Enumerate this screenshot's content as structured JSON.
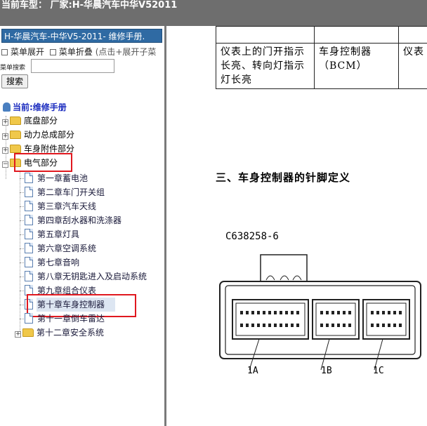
{
  "window": {
    "title_prefix": "当前车型：",
    "title_value": "厂家:H-华晨汽车中华V52011"
  },
  "sidebar": {
    "manual_title": "H-华晨汽车-中华V5-2011- 维修手册.",
    "expand_label": "菜单展开",
    "collapse_label": "菜单折叠",
    "collapse_hint": "(点击+展开子菜",
    "search_label": "菜单搜索",
    "search_value": "",
    "search_button": "搜索",
    "current_label": "当前:维修手册",
    "tree": [
      {
        "label": "底盘部分",
        "toggle": "+"
      },
      {
        "label": "动力总成部分",
        "toggle": "+"
      },
      {
        "label": "车身附件部分",
        "toggle": "+"
      },
      {
        "label": "电气部分",
        "toggle": "−"
      }
    ],
    "chapters": [
      {
        "label": "第一章蓄电池"
      },
      {
        "label": "第二章车门开关组"
      },
      {
        "label": "第三章汽车天线"
      },
      {
        "label": "第四章刮水器和洗涤器"
      },
      {
        "label": "第五章灯具"
      },
      {
        "label": "第六章空调系统"
      },
      {
        "label": "第七章音响"
      },
      {
        "label": "第八章无钥匙进入及启动系统"
      },
      {
        "label": "第九章组合仪表"
      },
      {
        "label": "第十章车身控制器"
      },
      {
        "label": "第十一章倒车雷达"
      },
      {
        "label": "第十二章安全系统"
      }
    ],
    "last_toggle": "+"
  },
  "document": {
    "table_rows": [
      {
        "col1": "",
        "col2": "",
        "col3": ""
      },
      {
        "col1": "仪表上的门开指示长亮、转向灯指示灯长亮",
        "col2": "车身控制器（BCM）",
        "col3": "仪表"
      }
    ],
    "section_heading": "三、车身控制器的针脚定义",
    "connector_part_number": "C638258-6",
    "connector_labels": [
      "1A",
      "1B",
      "1C"
    ]
  }
}
